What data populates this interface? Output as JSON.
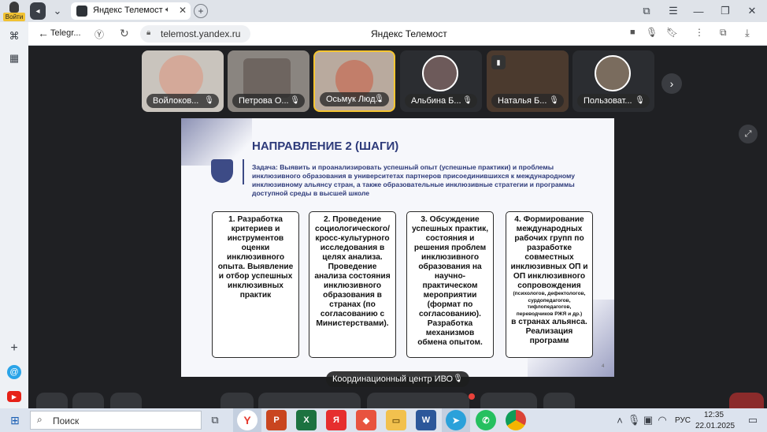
{
  "browser": {
    "tab_title": "Яндекс Телемост",
    "login_label": "Войти",
    "back_label": "Telegr...",
    "url": "telemost.yandex.ru",
    "page_title": "Яндекс Телемост"
  },
  "participants": [
    {
      "name": "Войлоков..."
    },
    {
      "name": "Петрова О..."
    },
    {
      "name": "Осьмук Люд..."
    },
    {
      "name": "Альбина Б..."
    },
    {
      "name": "Наталья Б..."
    },
    {
      "name": "Пользоват..."
    }
  ],
  "slide": {
    "title": "НАПРАВЛЕНИЕ 2 (ШАГИ)",
    "task": "Задача: Выявить и проанализировать успешный опыт (успешные практики) и проблемы инклюзивного образования в университетах партнеров присоединившихся к международному инклюзивному альянсу стран, а также образовательные инклюзивные стратегии и программы доступной среды в высшей школе",
    "steps": [
      {
        "text": "1. Разработка критериев и инструментов оценки инклюзивного опыта. Выявление и отбор успешных инклюзивных практик"
      },
      {
        "text": "2. Проведение социологического/ кросс-культурного исследования в целях анализа. Проведение анализа состояния инклюзивного образования в странах (по согласованию с Министерствами)."
      },
      {
        "text": "3. Обсуждение успешных практик, состояния и решения проблем инклюзивного образования на научно-практическом мероприятии (формат по согласованию). Разработка механизмов обмена опытом."
      },
      {
        "main": "4. Формирование международных рабочих групп по разработке совместных инклюзивных ОП и ОП инклюзивного сопровождения",
        "small": "(психологов, дефектологов, сурдопедагогов, тифлопедагогов, переводчиков РЖЯ и др.)",
        "tail": "в странах альянса. Реализация программ"
      }
    ],
    "page_number": "4"
  },
  "presenter_label": "Координационный центр ИВО",
  "taskbar": {
    "search_placeholder": "Поиск",
    "lang": "РУС",
    "time": "12:35",
    "date": "22.01.2025"
  }
}
